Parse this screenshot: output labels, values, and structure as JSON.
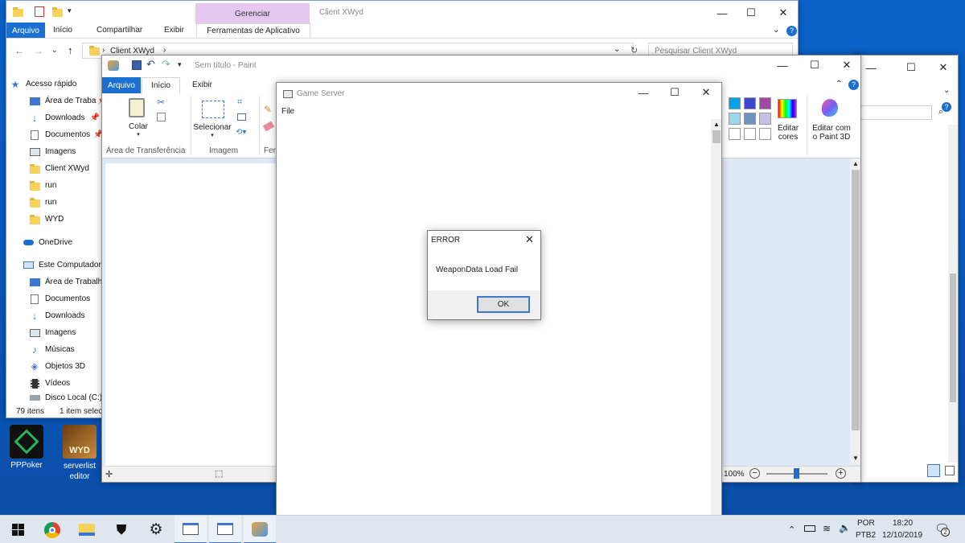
{
  "explorer": {
    "title": "Client XWyd",
    "context_tab": "Gerenciar",
    "tabs": [
      "Arquivo",
      "Início",
      "Compartilhar",
      "Exibir",
      "Ferramentas de Aplicativo"
    ],
    "address_path": "Client XWyd",
    "search_placeholder": "Pesquisar Client XWyd",
    "quick_access_label": "Acesso rápido",
    "quick_items": [
      "Área de Traba",
      "Downloads",
      "Documentos",
      "Imagens",
      "Client XWyd",
      "run",
      "run",
      "WYD"
    ],
    "onedrive_label": "OneDrive",
    "pc_label": "Este Computador",
    "pc_items": [
      "Área de Trabalho",
      "Documentos",
      "Downloads",
      "Imagens",
      "Músicas",
      "Objetos 3D",
      "Vídeos",
      "Disco Local (C:)"
    ],
    "status_count": "79 itens",
    "status_selected": "1 item selec"
  },
  "paint": {
    "title": "Sem título - Paint",
    "tabs": [
      "Arquivo",
      "Início",
      "Exibir"
    ],
    "groups": [
      "Área de Transferência",
      "Imagem",
      "Ferr"
    ],
    "colar_label": "Colar",
    "selecionar_label": "Selecionar",
    "editar_cores_label": "Editar cores",
    "paint3d_label": "Editar com o Paint 3D",
    "zoom_label": "100%",
    "colors": [
      "#00a2e8",
      "#3f48cc",
      "#a349a4",
      "#99d9ea",
      "#7092be",
      "#c8bfe7"
    ]
  },
  "game_server": {
    "title": "Game Server",
    "menu_file": "File"
  },
  "error_dialog": {
    "title": "ERROR",
    "message": "WeaponData Load Fail",
    "ok_label": "OK"
  },
  "desktop_icons": [
    {
      "label": "PPPoker"
    },
    {
      "label": "serverlist editor"
    }
  ],
  "taskbar": {
    "language": "POR",
    "layout": "PTB2",
    "time": "18:20",
    "date": "12/10/2019",
    "notification_count": "2"
  }
}
